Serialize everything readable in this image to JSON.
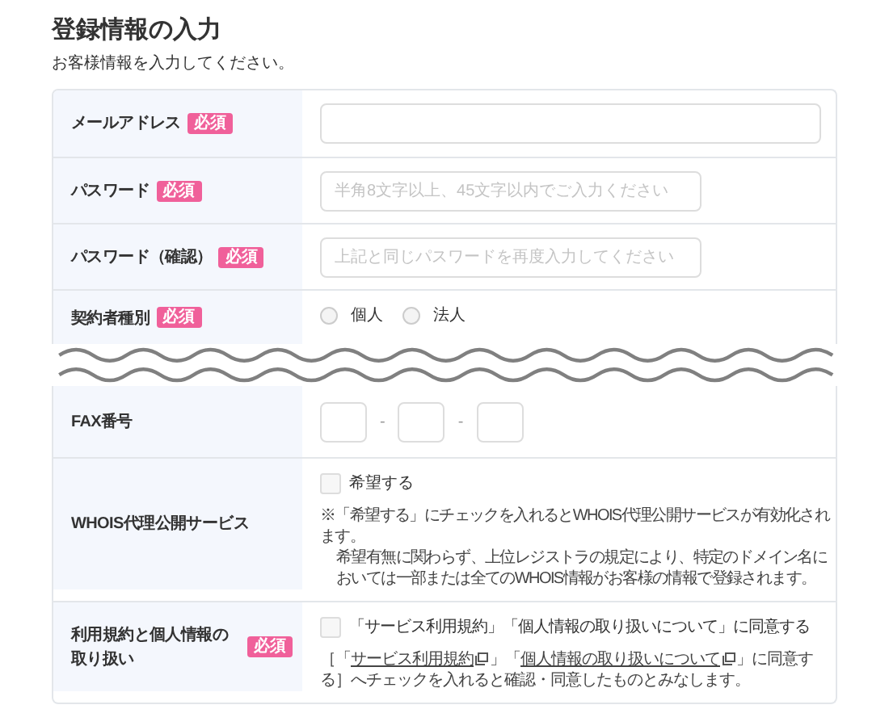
{
  "title": "登録情報の入力",
  "subtitle": "お客様情報を入力してください。",
  "rows": [
    {
      "kind": "text",
      "label": "メールアドレス",
      "required": "必須",
      "wide": true
    },
    {
      "kind": "text",
      "label": "パスワード",
      "required": "必須",
      "placeholder": "半角8文字以上、45文字以内でご入力ください"
    },
    {
      "kind": "text",
      "label": "パスワード（確認）",
      "required": "必須",
      "placeholder": "上記と同じパスワードを再度入力してください"
    },
    {
      "kind": "radio",
      "label": "契約者種別",
      "required": "必須",
      "options": [
        {
          "label": "個人",
          "selected": false
        },
        {
          "label": "法人",
          "selected": false
        }
      ]
    },
    {
      "kind": "fax",
      "label": "FAX番号",
      "separators": [
        "-",
        "-"
      ]
    },
    {
      "kind": "check",
      "label": "WHOIS代理公開サービス",
      "checkbox": {
        "label": "希望する",
        "checked": false
      },
      "notes": [
        "※「希望する」にチェックを入れるとWHOIS代理公開サービスが有効化されます。",
        "希望有無に関わらず、上位レジストラの規定により、特定のドメイン名においては一部または全てのWHOIS情報がお客様の情報で登録されます。"
      ]
    },
    {
      "kind": "terms",
      "label": "利用規約と個人情報の取り扱い",
      "required": "必須",
      "checkbox": {
        "label": "「サービス利用規約」「個人情報の取り扱いについて」に同意する",
        "checked": false
      },
      "note": {
        "open": "［「",
        "link1": "サービス利用規約",
        "mid": "」「",
        "link2": "個人情報の取り扱いについて",
        "rest": "」に同意する］へチェックを入れると確認・同意したものとみなします。"
      }
    }
  ]
}
